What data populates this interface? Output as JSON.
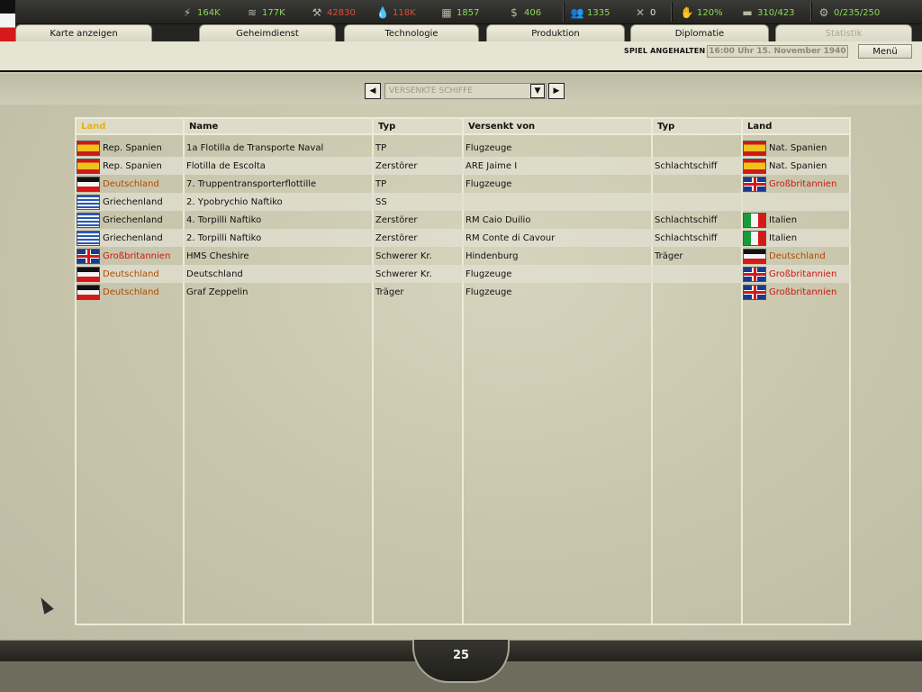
{
  "resources": [
    {
      "icon": "energy-icon",
      "glyph": "⚡",
      "value": "164K",
      "color": "green"
    },
    {
      "icon": "metal-icon",
      "glyph": "≋",
      "value": "177K",
      "color": "green"
    },
    {
      "icon": "rare-materials-icon",
      "glyph": "⚒",
      "value": "42830",
      "color": "red"
    },
    {
      "icon": "oil-icon",
      "glyph": "💧",
      "value": "118K",
      "color": "red"
    },
    {
      "icon": "supplies-icon",
      "glyph": "▦",
      "value": "1857",
      "color": "green"
    },
    {
      "icon": "money-icon",
      "glyph": "$",
      "value": "406",
      "color": "green"
    },
    {
      "icon": "manpower-icon",
      "glyph": "👥",
      "value": "1335",
      "color": "green"
    },
    {
      "icon": "diplomacy-icon",
      "glyph": "✕",
      "value": "0",
      "color": "white"
    },
    {
      "icon": "dissent-icon",
      "glyph": "✋",
      "value": "120%",
      "color": "green"
    },
    {
      "icon": "transport-icon",
      "glyph": "▬",
      "value": "310/423",
      "color": "green"
    },
    {
      "icon": "convoy-icon",
      "glyph": "⚙",
      "value": "0/235/250",
      "color": "green"
    }
  ],
  "tabs": [
    {
      "label": "Karte anzeigen",
      "active": false
    },
    {
      "label": "Geheimdienst",
      "active": false
    },
    {
      "label": "Technologie",
      "active": false
    },
    {
      "label": "Produktion",
      "active": false
    },
    {
      "label": "Diplomatie",
      "active": false
    },
    {
      "label": "Statistik",
      "active": true
    }
  ],
  "status": {
    "paused": "SPIEL ANGEHALTEN",
    "datetime": "16:00 Uhr 15. November 1940",
    "menu": "Menü"
  },
  "view_select": {
    "value": "VERSENKTE SCHIFFE"
  },
  "table": {
    "headers": [
      "Land",
      "Name",
      "Typ",
      "Versenkt von",
      "Typ",
      "Land"
    ],
    "rows": [
      {
        "country": "Rep. Spanien",
        "country_flag": "esp",
        "country_color": "black",
        "name": "1a Flotilla de Transporte Naval",
        "type": "TP",
        "sunk_by": "Flugzeuge",
        "sunk_type": "",
        "sunk_country": "Nat. Spanien",
        "sunk_flag": "esp",
        "sunk_color": "black"
      },
      {
        "country": "Rep. Spanien",
        "country_flag": "esp",
        "country_color": "black",
        "name": "Flotilla de Escolta",
        "type": "Zerstörer",
        "sunk_by": "ARE Jaime I",
        "sunk_type": "Schlachtschiff",
        "sunk_country": "Nat. Spanien",
        "sunk_flag": "esp",
        "sunk_color": "black"
      },
      {
        "country": "Deutschland",
        "country_flag": "ger",
        "country_color": "orange",
        "name": "7. Truppentransporterflottille",
        "type": "TP",
        "sunk_by": "Flugzeuge",
        "sunk_type": "",
        "sunk_country": "Großbritannien",
        "sunk_flag": "gbr",
        "sunk_color": "red"
      },
      {
        "country": "Griechenland",
        "country_flag": "gre",
        "country_color": "black",
        "name": "2. Ypobrychio Naftiko",
        "type": "SS",
        "sunk_by": "",
        "sunk_type": "",
        "sunk_country": "",
        "sunk_flag": "",
        "sunk_color": "black"
      },
      {
        "country": "Griechenland",
        "country_flag": "gre",
        "country_color": "black",
        "name": "4. Torpilli Naftiko",
        "type": "Zerstörer",
        "sunk_by": "RM Caio Duilio",
        "sunk_type": "Schlachtschiff",
        "sunk_country": "Italien",
        "sunk_flag": "ita",
        "sunk_color": "black"
      },
      {
        "country": "Griechenland",
        "country_flag": "gre",
        "country_color": "black",
        "name": "2. Torpilli Naftiko",
        "type": "Zerstörer",
        "sunk_by": "RM Conte di Cavour",
        "sunk_type": "Schlachtschiff",
        "sunk_country": "Italien",
        "sunk_flag": "ita",
        "sunk_color": "black"
      },
      {
        "country": "Großbritannien",
        "country_flag": "gbr",
        "country_color": "red",
        "name": "HMS Cheshire",
        "type": "Schwerer Kr.",
        "sunk_by": "Hindenburg",
        "sunk_type": "Träger",
        "sunk_country": "Deutschland",
        "sunk_flag": "ger",
        "sunk_color": "orange"
      },
      {
        "country": "Deutschland",
        "country_flag": "ger",
        "country_color": "orange",
        "name": "Deutschland",
        "type": "Schwerer Kr.",
        "sunk_by": "Flugzeuge",
        "sunk_type": "",
        "sunk_country": "Großbritannien",
        "sunk_flag": "gbr",
        "sunk_color": "red"
      },
      {
        "country": "Deutschland",
        "country_flag": "ger",
        "country_color": "orange",
        "name": "Graf Zeppelin",
        "type": "Träger",
        "sunk_by": "Flugzeuge",
        "sunk_type": "",
        "sunk_country": "Großbritannien",
        "sunk_flag": "gbr",
        "sunk_color": "red"
      }
    ]
  },
  "page": "25",
  "colors": {
    "accent_green": "#8ed857",
    "accent_red": "#e04b3a",
    "sorted_header": "#e1b21a"
  }
}
